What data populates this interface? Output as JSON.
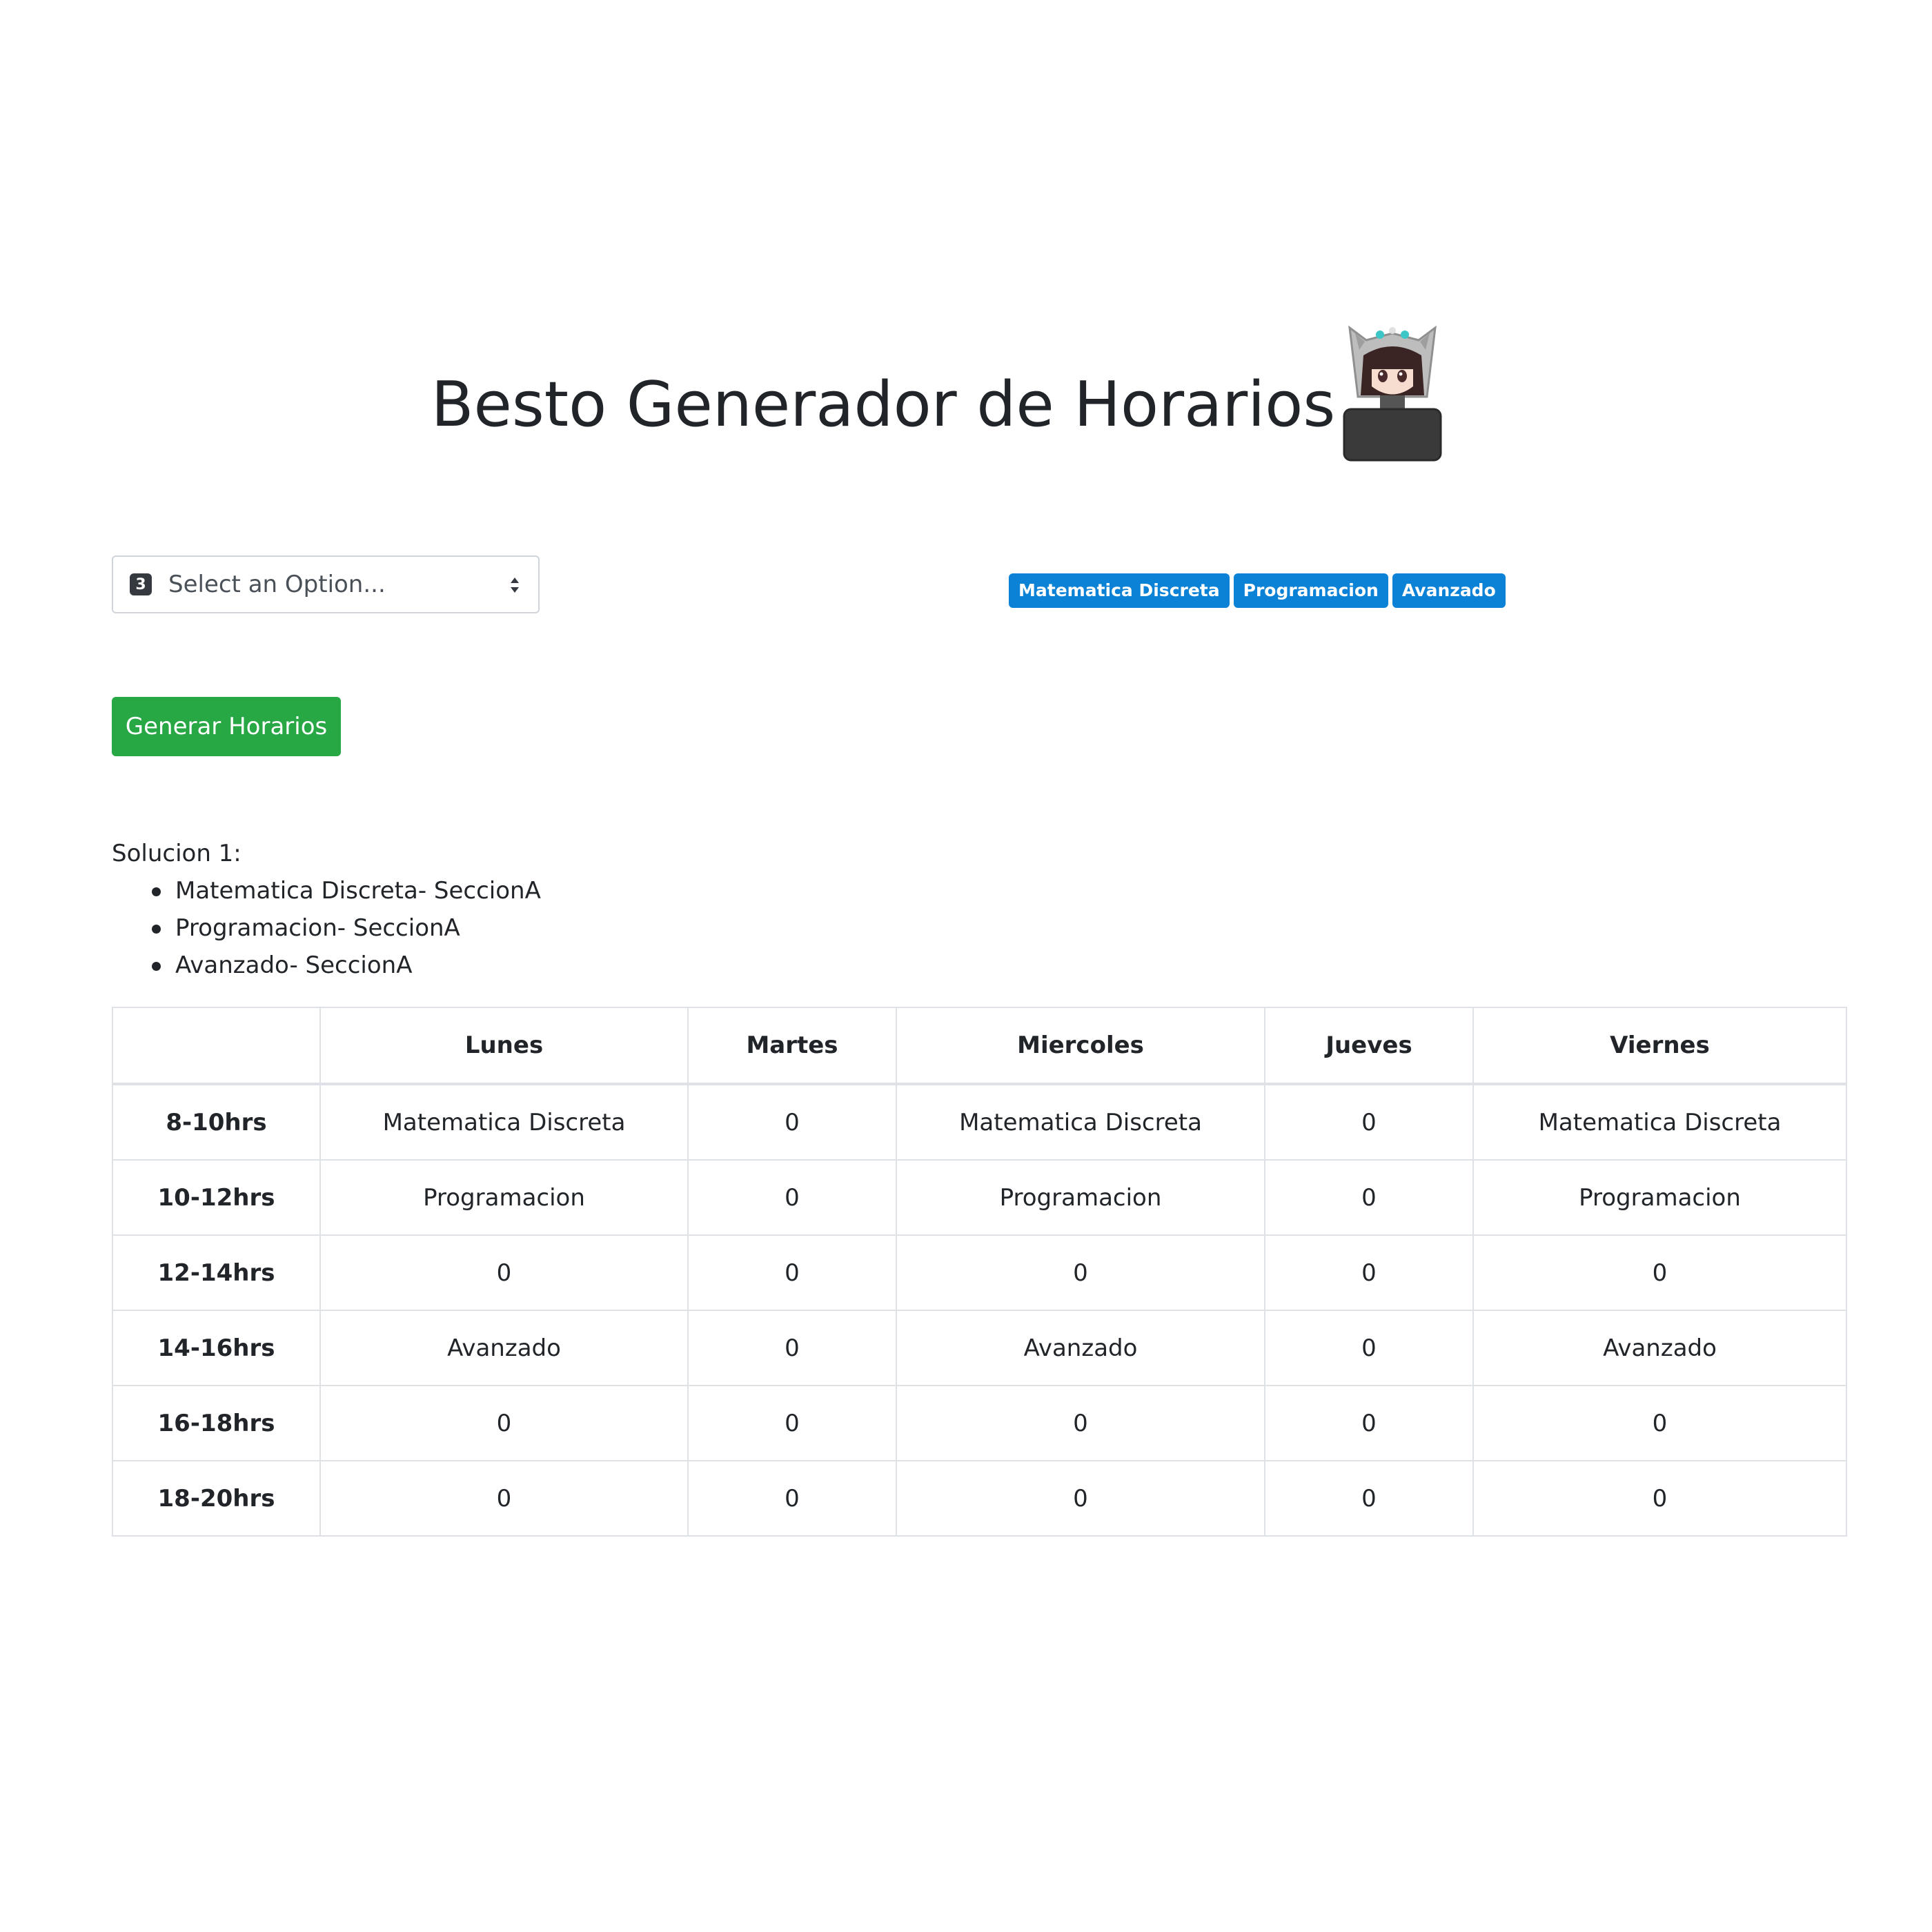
{
  "title": "Besto Generador de Horarios",
  "select": {
    "count": "3",
    "placeholder": "Select an Option..."
  },
  "tags": [
    "Matematica Discreta",
    "Programacion",
    "Avanzado"
  ],
  "generate_button": "Generar Horarios",
  "solution": {
    "heading": "Solucion 1:",
    "items": [
      "Matematica Discreta- SeccionA",
      "Programacion- SeccionA",
      "Avanzado- SeccionA"
    ]
  },
  "table": {
    "headers": [
      "",
      "Lunes",
      "Martes",
      "Miercoles",
      "Jueves",
      "Viernes"
    ],
    "rows": [
      {
        "time": "8-10hrs",
        "cells": [
          "Matematica Discreta",
          "0",
          "Matematica Discreta",
          "0",
          "Matematica Discreta"
        ]
      },
      {
        "time": "10-12hrs",
        "cells": [
          "Programacion",
          "0",
          "Programacion",
          "0",
          "Programacion"
        ]
      },
      {
        "time": "12-14hrs",
        "cells": [
          "0",
          "0",
          "0",
          "0",
          "0"
        ]
      },
      {
        "time": "14-16hrs",
        "cells": [
          "Avanzado",
          "0",
          "Avanzado",
          "0",
          "Avanzado"
        ]
      },
      {
        "time": "16-18hrs",
        "cells": [
          "0",
          "0",
          "0",
          "0",
          "0"
        ]
      },
      {
        "time": "18-20hrs",
        "cells": [
          "0",
          "0",
          "0",
          "0",
          "0"
        ]
      }
    ]
  },
  "colors": {
    "tag": "#0c82d6",
    "button": "#28a745",
    "border": "#dee2e6",
    "text": "#212529"
  },
  "icons": {
    "avatar": "hooded-girl-laptop-avatar",
    "select_arrows": "updown-arrows-icon"
  }
}
